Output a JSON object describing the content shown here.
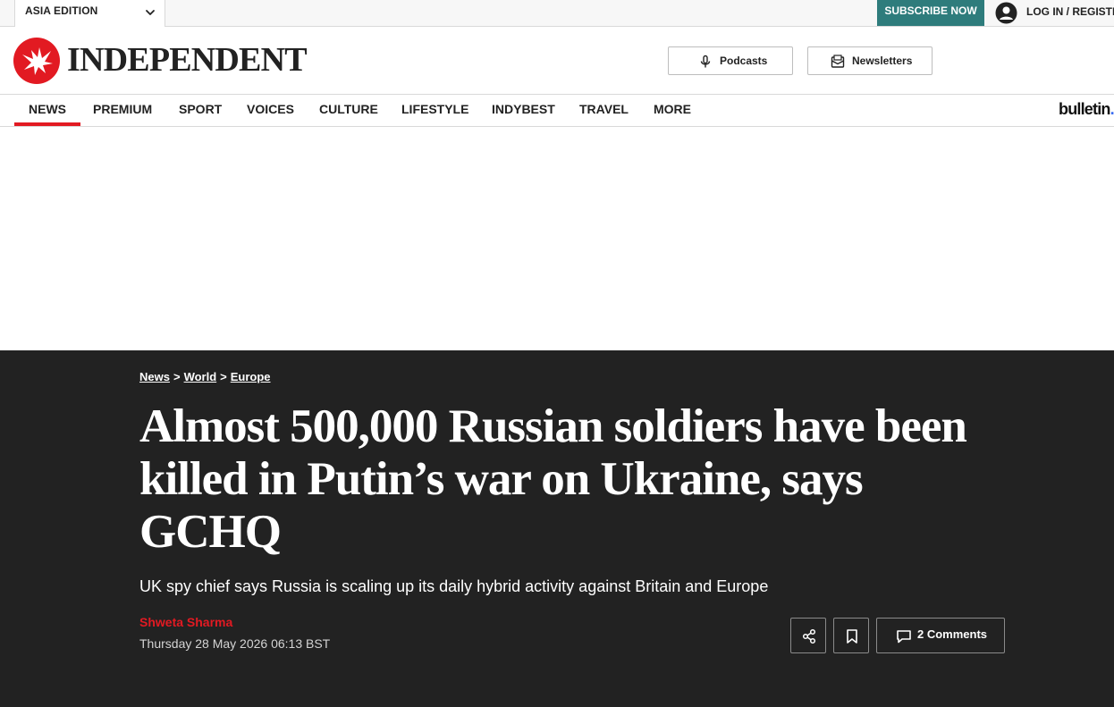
{
  "topbar": {
    "edition_label": "ASIA EDITION",
    "subscribe_label": "SUBSCRIBE NOW",
    "login_label": "LOG IN / REGISTER"
  },
  "masthead": {
    "logo_text": "INDEPENDENT",
    "podcasts_label": "Podcasts",
    "newsletters_label": "Newsletters"
  },
  "nav": {
    "items": [
      "NEWS",
      "PREMIUM",
      "SPORT",
      "VOICES",
      "CULTURE",
      "LIFESTYLE",
      "INDYBEST",
      "TRAVEL",
      "MORE"
    ],
    "active": "NEWS",
    "partner_logo": "bulletin",
    "partner_logo_dot": "."
  },
  "article": {
    "breadcrumb": [
      "News",
      "World",
      "Europe"
    ],
    "breadcrumb_separator": ">",
    "headline": "Almost 500,000 Russian soldiers have been killed in Putin’s war on Ukraine, says GCHQ",
    "standfirst": "UK spy chief says Russia is scaling up its daily hybrid activity against Britain and Europe",
    "author": "Shweta Sharma",
    "date": "Thursday 28 May 2026 06:13 BST",
    "comments_label": "2 Comments"
  },
  "colors": {
    "brand_red": "#e21a22",
    "subscribe_teal": "#2e7c7c",
    "hero_background": "#222222",
    "bulletin_dot": "#3a6cf0"
  },
  "icons": [
    "chevron-down-icon",
    "user-icon",
    "eagle-logo-icon",
    "microphone-icon",
    "newsletter-icon",
    "share-icon",
    "bookmark-icon",
    "comment-icon"
  ]
}
